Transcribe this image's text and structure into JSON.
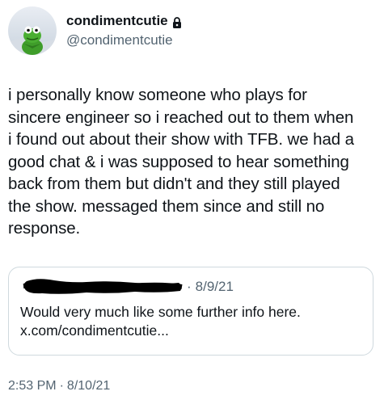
{
  "author": {
    "display_name": "condimentcutie",
    "handle": "@condimentcutie",
    "avatar_icon": "kermit-avatar-icon",
    "lock_icon": "lock-icon"
  },
  "tweet": {
    "text": "i personally know someone who plays for\nsincere engineer so i reached out to them when\ni found out about their show with TFB. we had a\ngood chat & i was supposed to hear something\nback from them but didn't and they still played\nthe show. messaged them since and still no\nresponse.",
    "time": "2:53 PM",
    "separator": "·",
    "date": "8/10/21"
  },
  "quote": {
    "separator": "·",
    "date": "8/9/21",
    "text": "Would very much like some further info here.",
    "link": "x.com/condimentcutie..."
  },
  "colors": {
    "text_primary": "#0f1419",
    "text_secondary": "#536471",
    "border": "#cfd9de",
    "redaction": "#000000"
  }
}
